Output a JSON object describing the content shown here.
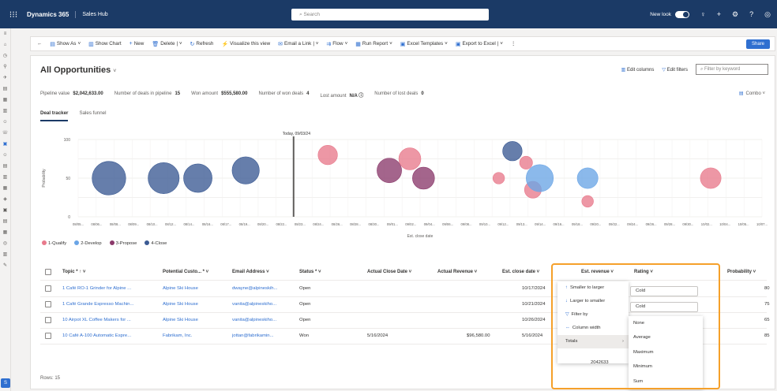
{
  "topbar": {
    "brand": "Dynamics 365",
    "app": "Sales Hub",
    "search_placeholder": "Search",
    "new_look": "New look"
  },
  "commands": [
    {
      "icon": "▤",
      "label": "Show As"
    },
    {
      "icon": "▥",
      "label": "Show Chart"
    },
    {
      "icon": "+",
      "label": "New"
    },
    {
      "icon": "🗑",
      "label": "Delete"
    },
    {
      "icon": "↻",
      "label": "Refresh"
    },
    {
      "icon": "⚡",
      "label": "Visualize this view"
    },
    {
      "icon": "✉",
      "label": "Email a Link"
    },
    {
      "icon": "⇉",
      "label": "Flow"
    },
    {
      "icon": "▦",
      "label": "Run Report"
    },
    {
      "icon": "▣",
      "label": "Excel Templates"
    },
    {
      "icon": "▣",
      "label": "Export to Excel"
    }
  ],
  "share_label": "Share",
  "view": {
    "title": "All Opportunities",
    "edit_columns": "Edit columns",
    "edit_filters": "Edit filters",
    "filter_placeholder": "Filter by keyword"
  },
  "metrics": [
    {
      "label": "Pipeline value",
      "value": "$2,042,633.00"
    },
    {
      "label": "Number of deals in pipeline",
      "value": "15"
    },
    {
      "label": "Won amount",
      "value": "$555,580.00"
    },
    {
      "label": "Number of won deals",
      "value": "4"
    },
    {
      "label": "Lost amount",
      "value": "N/A ⓘ"
    },
    {
      "label": "Number of lost deals",
      "value": "0"
    }
  ],
  "combo_label": "Combo",
  "tabs": [
    {
      "label": "Deal tracker",
      "active": true
    },
    {
      "label": "Sales funnel",
      "active": false
    }
  ],
  "chart_data": {
    "type": "scatter",
    "today_label": "Today, 09/03/24",
    "xlabel": "Est. close date",
    "ylabel": "Probability",
    "yticks": [
      "100",
      "50",
      "0"
    ],
    "ylim": [
      0,
      100
    ],
    "legend": [
      {
        "name": "1-Qualify",
        "color": "#e87a8c"
      },
      {
        "name": "2-Develop",
        "color": "#6aa5e6"
      },
      {
        "name": "3-Propose",
        "color": "#8b3a6b"
      },
      {
        "name": "4-Close",
        "color": "#3b5a93"
      }
    ],
    "points": [
      {
        "x": 0.045,
        "y": 50,
        "r": 26,
        "stage": 3
      },
      {
        "x": 0.125,
        "y": 50,
        "r": 24,
        "stage": 3
      },
      {
        "x": 0.175,
        "y": 50,
        "r": 22,
        "stage": 3
      },
      {
        "x": 0.245,
        "y": 60,
        "r": 21,
        "stage": 3
      },
      {
        "x": 0.365,
        "y": 80,
        "r": 15,
        "stage": 0
      },
      {
        "x": 0.455,
        "y": 60,
        "r": 19,
        "stage": 2
      },
      {
        "x": 0.485,
        "y": 75,
        "r": 17,
        "stage": 0
      },
      {
        "x": 0.505,
        "y": 50,
        "r": 17,
        "stage": 2
      },
      {
        "x": 0.615,
        "y": 50,
        "r": 9,
        "stage": 0
      },
      {
        "x": 0.635,
        "y": 85,
        "r": 15,
        "stage": 3
      },
      {
        "x": 0.655,
        "y": 70,
        "r": 10,
        "stage": 0
      },
      {
        "x": 0.665,
        "y": 35,
        "r": 13,
        "stage": 0
      },
      {
        "x": 0.675,
        "y": 50,
        "r": 21,
        "stage": 1
      },
      {
        "x": 0.745,
        "y": 50,
        "r": 16,
        "stage": 1
      },
      {
        "x": 0.745,
        "y": 20,
        "r": 9,
        "stage": 0
      },
      {
        "x": 0.925,
        "y": 50,
        "r": 16,
        "stage": 0
      }
    ],
    "xticks": [
      "08/05...",
      "08/06...",
      "08/08...",
      "08/09...",
      "08/10...",
      "08/12...",
      "08/14...",
      "08/16...",
      "08/17...",
      "08/19...",
      "08/20...",
      "08/22...",
      "08/23...",
      "08/24...",
      "08/26...",
      "08/28...",
      "08/30...",
      "09/01...",
      "09/02...",
      "09/04...",
      "09/06...",
      "09/08...",
      "09/10...",
      "09/12...",
      "09/13...",
      "09/14...",
      "09/16...",
      "09/18...",
      "09/20...",
      "09/22...",
      "09/24...",
      "09/26...",
      "09/28...",
      "09/30...",
      "10/02...",
      "10/04...",
      "10/05...",
      "10/07..."
    ]
  },
  "grid": {
    "columns": [
      "Topic * ↑ ˅",
      "Potential Custo... * ˅",
      "Email Address ˅",
      "Status * ˅",
      "Actual Close Date ˅",
      "Actual Revenue ˅",
      "Est. close date ˅",
      "Est. revenue ˅",
      "Rating ˅",
      "Probability ˅"
    ],
    "rows": [
      {
        "topic": "1 Café RO-1 Grinder for Alpine ...",
        "customer": "Alpine Ski House",
        "email": "dwayne@alpineskih...",
        "status": "Open",
        "close_date": "",
        "revenue": "",
        "est_close": "10/17/2024",
        "rating": "Cold",
        "probability": "80"
      },
      {
        "topic": "1 Café Grande Espresso Machin...",
        "customer": "Alpine Ski House",
        "email": "vanita@alpineskiho...",
        "status": "Open",
        "close_date": "",
        "revenue": "",
        "est_close": "10/21/2024",
        "rating": "Cold",
        "probability": "75"
      },
      {
        "topic": "10 Airpot XL Coffee Makers for ...",
        "customer": "Alpine Ski House",
        "email": "vanita@alpineskiho...",
        "status": "Open",
        "close_date": "",
        "revenue": "",
        "est_close": "10/26/2024",
        "rating": "",
        "probability": "65"
      },
      {
        "topic": "10 Café A-100 Automatic Espre...",
        "customer": "Fabrikam, Inc.",
        "email": "jottan@fabrikamin...",
        "status": "Won",
        "close_date": "5/16/2024",
        "revenue": "$96,580.00",
        "est_close": "5/16/2024",
        "rating": "",
        "probability": "85"
      }
    ],
    "rows_count": "Rows: 15"
  },
  "sort_menu": [
    {
      "icon": "↑",
      "label": "Smaller to larger"
    },
    {
      "icon": "↓",
      "label": "Larger to smaller"
    },
    {
      "icon": "▽",
      "label": "Filter by"
    },
    {
      "icon": "⇔",
      "label": "Column width"
    },
    {
      "icon": "",
      "label": "Totals"
    }
  ],
  "totals_value": "2042633",
  "totals_menu": [
    "None",
    "Average",
    "Maximum",
    "Minimum",
    "Sum"
  ]
}
